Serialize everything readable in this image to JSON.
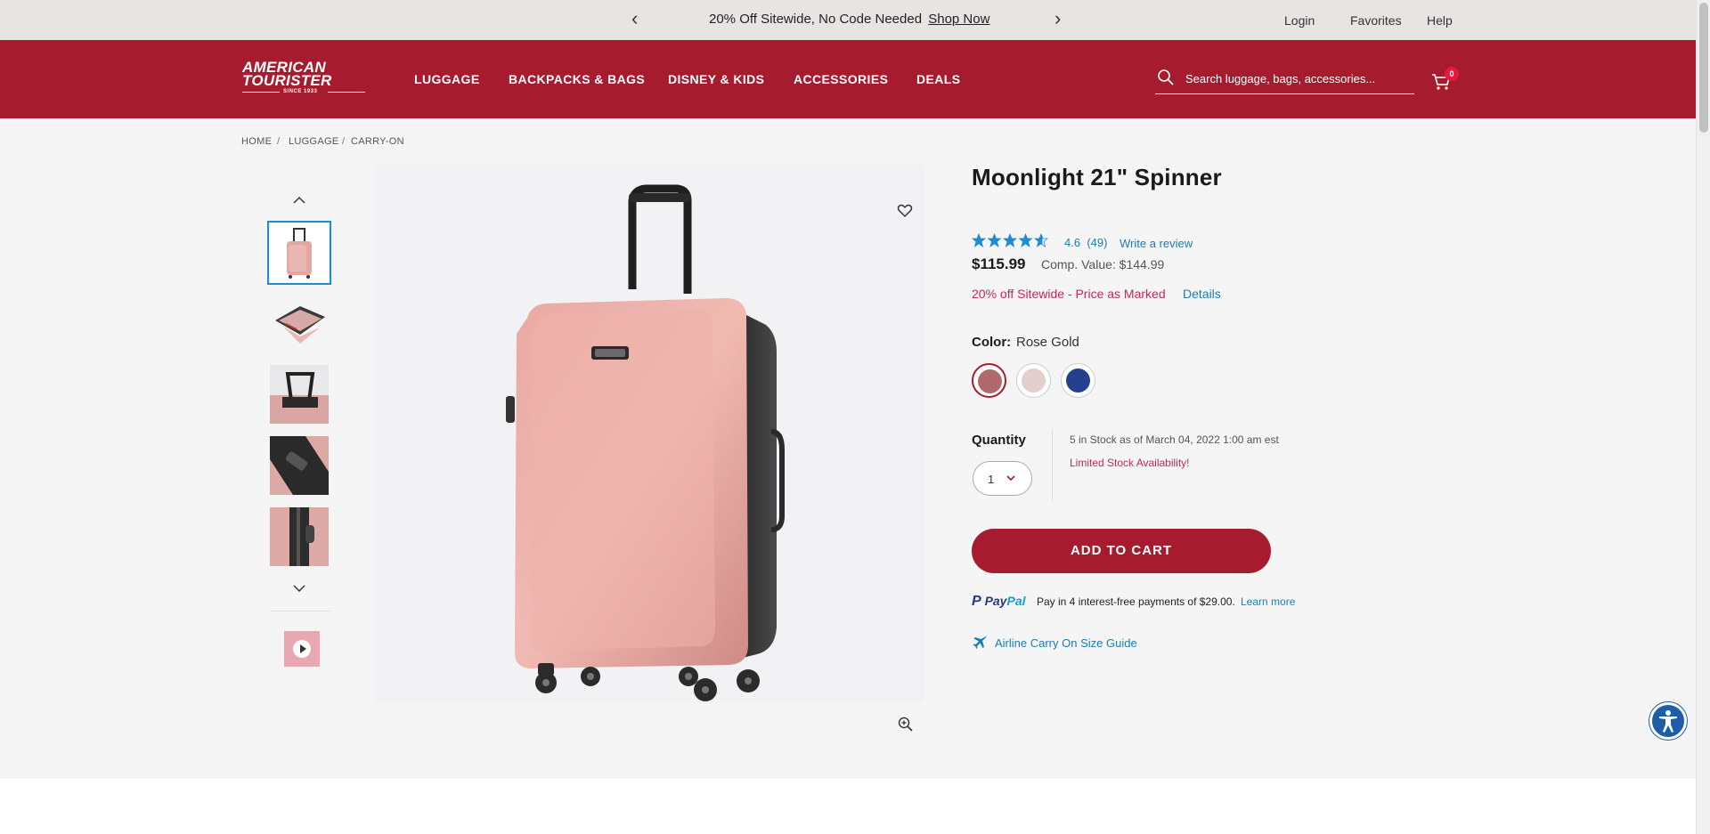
{
  "promo": {
    "message": "20% Off Sitewide, No Code Needed",
    "link": "Shop Now",
    "prev": "‹",
    "next": "›"
  },
  "utility_nav": {
    "login": "Login",
    "favorites": "Favorites",
    "help": "Help"
  },
  "brand": {
    "line1": "AMERICAN",
    "line2": "TOURISTER",
    "since": "SINCE 1933",
    "color": "#a61b2e"
  },
  "nav": {
    "luggage": "LUGGAGE",
    "backpacks": "BACKPACKS & BAGS",
    "disney": "DISNEY & KIDS",
    "accessories": "ACCESSORIES",
    "deals": "DEALS"
  },
  "search": {
    "placeholder": "Search luggage, bags, accessories...",
    "icon": "search-icon"
  },
  "cart": {
    "count": "0",
    "icon": "cart-icon"
  },
  "breadcrumb": {
    "home": "HOME",
    "luggage": "LUGGAGE",
    "carry_on": "CARRY-ON",
    "sep": "/"
  },
  "product": {
    "title": "Moonlight 21\" Spinner",
    "rating_value": 4.6,
    "rating_text": "4.6",
    "review_count": "(49)",
    "write_review": "Write a review",
    "price": "$115.99",
    "comp_value": "Comp. Value: $144.99",
    "promo_text": "20% off Sitewide - Price as Marked",
    "promo_details": "Details",
    "color_label": "Color:",
    "color_value": "Rose Gold",
    "swatches": [
      {
        "name": "Rose Gold",
        "color": "#b06a6c"
      },
      {
        "name": "Rose Marble",
        "color": "#e4cfcf"
      },
      {
        "name": "Galaxy Blue",
        "color": "#24408e"
      }
    ],
    "quantity_label": "Quantity",
    "quantity_value": "1",
    "stock_text": "5 in Stock as of March 04, 2022 1:00 am est",
    "limited_text": "Limited Stock Availability!",
    "add_to_cart": "ADD TO CART",
    "paypal_logo_pay": "Pay",
    "paypal_logo_pal": "Pal",
    "paypal_text": "Pay in 4 interest-free payments of $29.00.",
    "paypal_learn": "Learn more",
    "size_guide": "Airline Carry On Size Guide"
  },
  "colors": {
    "brand_red": "#a61b2e",
    "link_blue": "#1b7db3",
    "promo_pink": "#c0285a",
    "star_blue": "#1e8ccf",
    "case_rose": "#e3a7a2"
  }
}
